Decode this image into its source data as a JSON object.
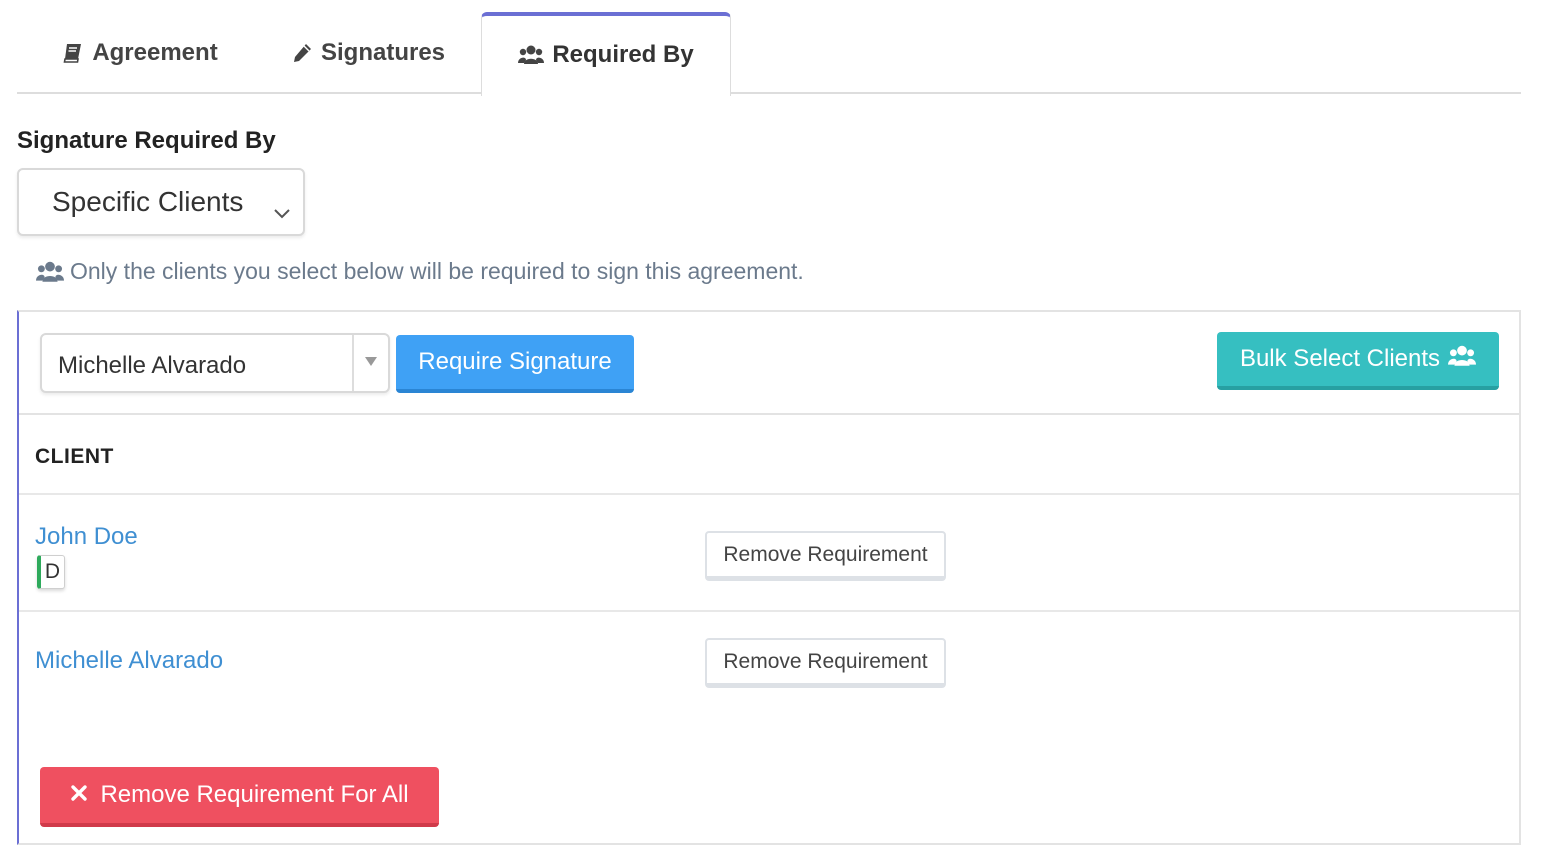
{
  "tabs": [
    {
      "label": "Agreement",
      "icon": "book-icon",
      "active": false
    },
    {
      "label": "Signatures",
      "icon": "pencil-icon",
      "active": false
    },
    {
      "label": "Required By",
      "icon": "users-icon",
      "active": true
    }
  ],
  "required_by": {
    "section_label": "Signature Required By",
    "scope_value": "Specific Clients",
    "hint_text": "Only the clients you select below will be required to sign this agreement."
  },
  "toolbar": {
    "client_select_value": "Michelle Alvarado",
    "require_button_label": "Require Signature",
    "bulk_button_label": "Bulk Select Clients"
  },
  "table": {
    "column_header": "CLIENT",
    "rows": [
      {
        "client": "John Doe",
        "badge": "D",
        "action_label": "Remove Requirement"
      },
      {
        "client": "Michelle Alvarado",
        "action_label": "Remove Requirement"
      }
    ]
  },
  "footer": {
    "remove_all_label": "Remove Requirement For All"
  },
  "colors": {
    "accent": "#6b6fd4",
    "primary": "#3fa1f5",
    "info": "#36bfc1",
    "danger": "#ef5060",
    "link": "#3f8fd2",
    "badge_stripe": "#2eaa5c"
  }
}
